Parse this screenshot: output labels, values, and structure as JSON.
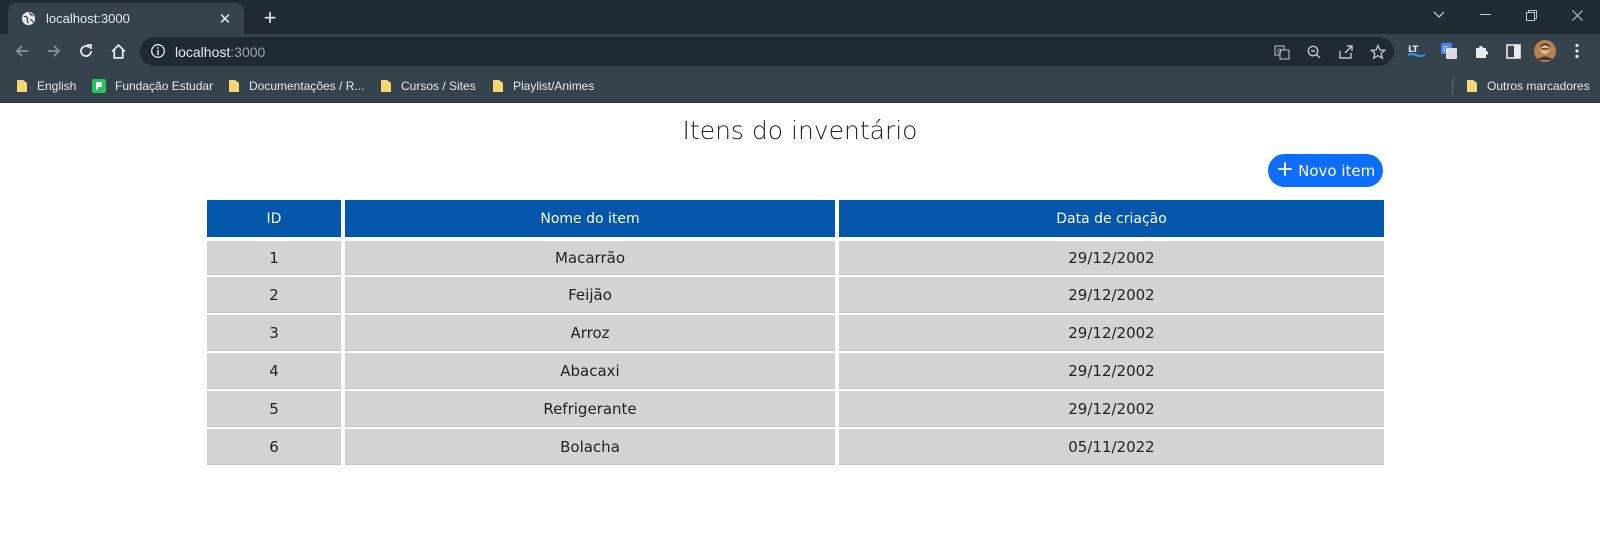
{
  "browser": {
    "tab_title": "localhost:3000",
    "url_host": "localhost",
    "url_port": ":3000",
    "bookmarks": [
      {
        "label": "English",
        "icon": "folder-icon"
      },
      {
        "label": "Fundação Estudar",
        "icon": "fundacao-favicon-icon"
      },
      {
        "label": "Documentações / R...",
        "icon": "folder-icon"
      },
      {
        "label": "Cursos / Sites",
        "icon": "folder-icon"
      },
      {
        "label": "Playlist/Animes",
        "icon": "folder-icon"
      }
    ],
    "other_bookmarks": "Outros marcadores"
  },
  "page": {
    "title": "Itens do inventário",
    "new_button_label": "Novo item",
    "new_button_icon": "plus-icon",
    "accent_color": "#0d6efd",
    "header_color": "#0357ab"
  },
  "table": {
    "columns": [
      "ID",
      "Nome do item",
      "Data de criação"
    ],
    "rows": [
      {
        "id": "1",
        "name": "Macarrão",
        "date": "29/12/2002"
      },
      {
        "id": "2",
        "name": "Feijão",
        "date": "29/12/2002"
      },
      {
        "id": "3",
        "name": "Arroz",
        "date": "29/12/2002"
      },
      {
        "id": "4",
        "name": "Abacaxi",
        "date": "29/12/2002"
      },
      {
        "id": "5",
        "name": "Refrigerante",
        "date": "29/12/2002"
      },
      {
        "id": "6",
        "name": "Bolacha",
        "date": "05/11/2022"
      }
    ]
  }
}
